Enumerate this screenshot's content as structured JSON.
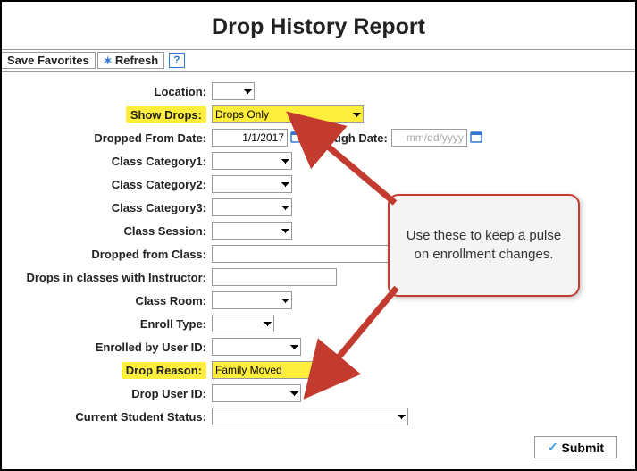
{
  "title": "Drop History Report",
  "toolbar": {
    "save_favorites": "Save Favorites",
    "refresh": "Refresh"
  },
  "form": {
    "location_label": "Location:",
    "location_value": "",
    "show_drops_label": "Show Drops:",
    "show_drops_value": "Drops Only",
    "dropped_from_date_label": "Dropped From Date:",
    "dropped_from_date_value": "1/1/2017",
    "through_date_label": "Through Date:",
    "through_date_placeholder": "mm/dd/yyyy",
    "through_date_value": "",
    "class_cat1_label": "Class Category1:",
    "class_cat2_label": "Class Category2:",
    "class_cat3_label": "Class Category3:",
    "class_session_label": "Class Session:",
    "dropped_from_class_label": "Dropped from Class:",
    "drops_instructor_label": "Drops in classes with Instructor:",
    "class_room_label": "Class Room:",
    "enroll_type_label": "Enroll Type:",
    "enrolled_by_user_label": "Enrolled by User ID:",
    "drop_reason_label": "Drop Reason:",
    "drop_reason_value": "Family Moved",
    "drop_user_label": "Drop User ID:",
    "current_status_label": "Current Student Status:",
    "submit": "Submit"
  },
  "callout": {
    "text": "Use these to keep a pulse on enrollment changes."
  }
}
